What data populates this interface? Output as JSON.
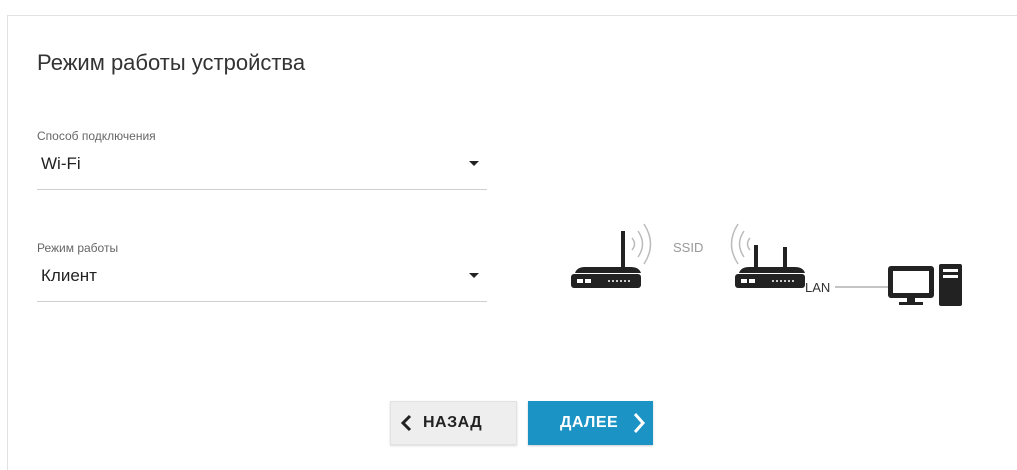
{
  "page": {
    "title": "Режим работы устройства"
  },
  "connection": {
    "label": "Способ подключения",
    "value": "Wi-Fi"
  },
  "mode": {
    "label": "Режим работы",
    "value": "Клиент"
  },
  "diagram": {
    "ssid_label": "SSID",
    "lan_label": "LAN",
    "icons": [
      "router-icon",
      "wifi-waves-icon",
      "router-icon",
      "computer-icon"
    ]
  },
  "buttons": {
    "back_label": "НАЗАД",
    "next_label": "ДАЛЕЕ"
  },
  "colors": {
    "accent": "#1b94c5",
    "icon": "#222222",
    "wave": "#bbbbbb"
  }
}
